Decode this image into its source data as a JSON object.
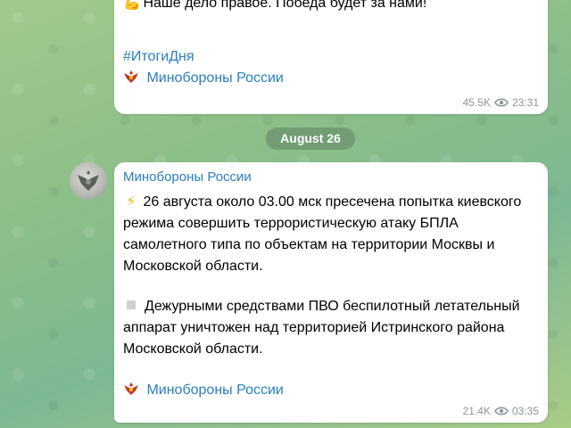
{
  "chat": {
    "post1": {
      "line1_emoji": "💪",
      "line1_text": "Наше дело правое. Победа будет за нами!",
      "hashtag": "#ИтогиДня",
      "signature_link": "Минобороны России",
      "views": "45.5K",
      "time": "23:31"
    },
    "date_divider": "August 26",
    "post2": {
      "sender": "Минобороны России",
      "para1_emoji": "⚡",
      "para1_lines": [
        "26 августа около 03.00 мск пресечена попытка киевского",
        "режима совершить террористическую атаку БПЛА",
        "самолетного типа по объектам на территории Москвы и",
        "Московской области."
      ],
      "para2_lines": [
        "Дежурными средствами ПВО беспилотный летательный",
        "аппарат уничтожен над территорией Истринского района",
        "Московской области."
      ],
      "signature_link": "Минобороны России",
      "views": "21.4K",
      "time": "03:35"
    }
  },
  "icons": {
    "views": "eye-icon",
    "emblem": "ministry-emblem-icon",
    "bullet": "white-square-icon"
  },
  "colors": {
    "link": "#2a7fc0",
    "meta": "#8a969c",
    "bubble": "#ffffff"
  }
}
